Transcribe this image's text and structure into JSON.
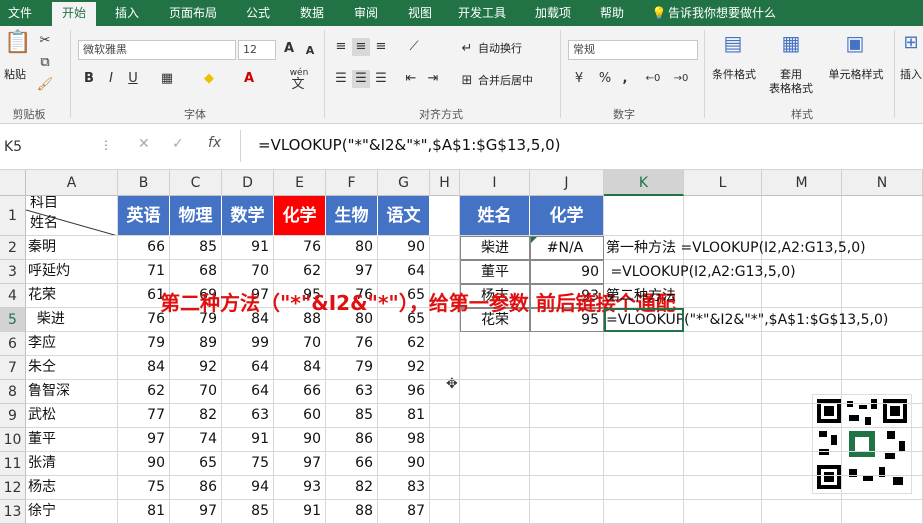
{
  "tabs": [
    "文件",
    "开始",
    "插入",
    "页面布局",
    "公式",
    "数据",
    "审阅",
    "视图",
    "开发工具",
    "加载项",
    "帮助"
  ],
  "tell_me": "告诉我你想要做什么",
  "ribbon": {
    "paste": "粘贴",
    "clipboard": "剪贴板",
    "font_name": "微软雅黑",
    "font_size": "12",
    "font_group": "字体",
    "align_group": "对齐方式",
    "wrap_text": "自动换行",
    "merge_center": "合并后居中",
    "number_format": "常规",
    "number_group": "数字",
    "cond_format": "条件格式",
    "table_format_1": "套用",
    "table_format_2": "表格格式",
    "cell_styles": "单元格样式",
    "styles_group": "样式",
    "insert": "插入",
    "bold": "B",
    "italic": "I",
    "underline": "U",
    "font_color": "A",
    "grow_font": "A",
    "shrink_font": "A",
    "wen": "wén",
    "wen_char": "文",
    "percent": "%",
    "comma": ",",
    "pct_decimals_inc": "←0",
    "pct_decimals_dec": "→0"
  },
  "formula_bar": {
    "name_box": "K5",
    "fx": "fx",
    "formula": "=VLOOKUP(\"*\"&I2&\"*\",$A$1:$G$13,5,0)"
  },
  "columns": [
    "A",
    "B",
    "C",
    "D",
    "E",
    "F",
    "G",
    "H",
    "I",
    "J",
    "K",
    "L",
    "M",
    "N"
  ],
  "rows": [
    "1",
    "2",
    "3",
    "4",
    "5",
    "6",
    "7",
    "8",
    "9",
    "10",
    "11",
    "12",
    "13"
  ],
  "table1": {
    "corner_top": "科目",
    "corner_bottom": "姓名",
    "headers": [
      "英语",
      "物理",
      "数学",
      "化学",
      "生物",
      "语文"
    ],
    "data": [
      {
        "name": "秦明",
        "v": [
          "66",
          "85",
          "91",
          "76",
          "80",
          "90"
        ]
      },
      {
        "name": "呼延灼",
        "v": [
          "71",
          "68",
          "70",
          "62",
          "97",
          "64"
        ]
      },
      {
        "name": "花荣",
        "v": [
          "61",
          "69",
          "97",
          "95",
          "76",
          "65"
        ]
      },
      {
        "name": "  柴进",
        "v": [
          "76",
          "79",
          "84",
          "88",
          "80",
          "65"
        ]
      },
      {
        "name": "李应",
        "v": [
          "79",
          "89",
          "99",
          "70",
          "76",
          "62"
        ]
      },
      {
        "name": "朱仝",
        "v": [
          "84",
          "92",
          "64",
          "84",
          "79",
          "92"
        ]
      },
      {
        "name": "鲁智深",
        "v": [
          "62",
          "70",
          "64",
          "66",
          "63",
          "96"
        ]
      },
      {
        "name": "武松",
        "v": [
          "77",
          "82",
          "63",
          "60",
          "85",
          "81"
        ]
      },
      {
        "name": "董平",
        "v": [
          "97",
          "74",
          "91",
          "90",
          "86",
          "98"
        ]
      },
      {
        "name": "张清",
        "v": [
          "90",
          "65",
          "75",
          "97",
          "66",
          "90"
        ]
      },
      {
        "name": "杨志",
        "v": [
          "75",
          "86",
          "94",
          "93",
          "82",
          "83"
        ]
      },
      {
        "name": "徐宁",
        "v": [
          "81",
          "97",
          "85",
          "91",
          "88",
          "87"
        ]
      }
    ]
  },
  "table2": {
    "h_name": "姓名",
    "h_chem": "化学",
    "rows": [
      {
        "name": "柴进",
        "chem": "#N/A"
      },
      {
        "name": "董平",
        "chem": "90"
      },
      {
        "name": "杨志",
        "chem": "93"
      },
      {
        "name": "花荣",
        "chem": "95"
      }
    ]
  },
  "notes": {
    "k2": "第一种方法 =VLOOKUP(I2,A2:G13,5,0)",
    "k3": " =VLOOKUP(I2,A2:G13,5,0)",
    "k4": "第二种方法",
    "k5": "=VLOOKUP(\"*\"&I2&\"*\",$A$1:$G$13,5,0)"
  },
  "caption": "第二种方法（\"*\"&I2&\"*\"），给第一参数 前后链接个通配",
  "colors": {
    "excel_green": "#217346",
    "header_blue": "#4472c4",
    "header_red": "#ff0000",
    "caption_red": "#e01010"
  }
}
